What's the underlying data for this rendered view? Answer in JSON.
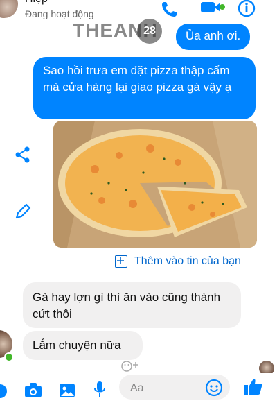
{
  "header": {
    "contact_name": "Hiệp",
    "status": "Đang hoạt động",
    "icons": [
      "phone-icon",
      "video-icon",
      "info-icon"
    ],
    "online_color": "#42b72a"
  },
  "watermark": {
    "text": "THEANH",
    "badge": "28"
  },
  "messages": {
    "sent_1": "Ủa anh ơi.",
    "sent_2": "Sao hồi trưa em đặt pizza thập cẩm mà cửa hàng lại giao pizza gà vậy ạ",
    "received_1": "Gà hay lợn gì thì ăn vào cũng thành cứt thôi",
    "received_2": "Lắm chuyện nữa"
  },
  "add_to_story": "Thêm vào tin của bạn",
  "composer": {
    "placeholder": "Aa"
  },
  "colors": {
    "accent": "#0084ff",
    "bubble_in": "#f1f0f0"
  }
}
